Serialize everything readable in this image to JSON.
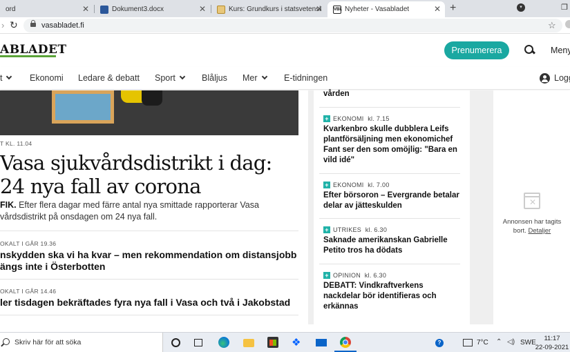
{
  "browser": {
    "tabs": [
      {
        "title": "ord",
        "icon": "document-icon"
      },
      {
        "title": "Dokument3.docx",
        "icon": "word-icon"
      },
      {
        "title": "Kurs: Grundkurs i statsvetenskap",
        "icon": "course-icon"
      },
      {
        "title": "Nyheter - Vasabladet",
        "icon": "vbl-icon",
        "favicon_text": "VBL"
      }
    ],
    "url": "vasabladet.fi"
  },
  "site": {
    "logo": "ABLADET",
    "subscribe_label": "Prenumerera",
    "menu_label": "Meny",
    "nav": [
      {
        "label": "t",
        "dropdown": true
      },
      {
        "label": "Ekonomi",
        "dropdown": false
      },
      {
        "label": "Ledare & debatt",
        "dropdown": false
      },
      {
        "label": "Sport",
        "dropdown": true
      },
      {
        "label": "Blåljus",
        "dropdown": false
      },
      {
        "label": "Mer",
        "dropdown": true
      },
      {
        "label": "E-tidningen",
        "dropdown": false
      }
    ],
    "login_label": "Logg",
    "accent_color": "#1aa8a1",
    "logo_bar_color": "#5aa338"
  },
  "main": {
    "top_kicker": "T   KL. 11.04",
    "headline_line1": "Vasa sjukvårdsdistrikt i dag:",
    "headline_line2": "24 nya fall av corona",
    "lead_bold": "FIK.",
    "lead_line1": " Efter flera dagar med färre antal nya smittade rapporterar Vasa",
    "lead_line2": "vårdsdistrikt på onsdagen om 24 nya fall.",
    "article2_kicker": "OKALT   I GÅR 19.36",
    "article2_line1": "nskydden ska vi ha kvar – men rekommendation om distansjobb",
    "article2_line2": "ängs inte i Österbotten",
    "article3_kicker": "OKALT   I GÅR 14.46",
    "article3_line1": "ler tisdagen bekräftades fyra nya fall i Vasa och två i Jakobstad"
  },
  "sidebar": {
    "top_fragment": "vården",
    "items": [
      {
        "category": "EKONOMI",
        "time": "kl. 7.15",
        "title": "Kvarkenbro skulle dubblera Leifs plantförsäljning men ekonomichef Fant ser den som omöjlig: \"Bara en vild idé\""
      },
      {
        "category": "EKONOMI",
        "time": "kl. 7.00",
        "title": "Efter börsoron – Evergrande betalar delar av jätteskulden"
      },
      {
        "category": "UTRIKES",
        "time": "kl. 6.30",
        "title": "Saknade amerikanskan Gabrielle Petito tros ha dödats"
      },
      {
        "category": "OPINION",
        "time": "kl. 6.30",
        "title": "DEBATT: Vindkraftverkens nackdelar bör identifieras och erkännas"
      }
    ]
  },
  "ad": {
    "text": "Annonsen har tagits bort.",
    "link": "Detaljer"
  },
  "taskbar": {
    "search_placeholder": "Skriv här för att söka",
    "temperature": "7°C",
    "language": "SWE",
    "time": "11:17",
    "date": "22-09-2021"
  }
}
